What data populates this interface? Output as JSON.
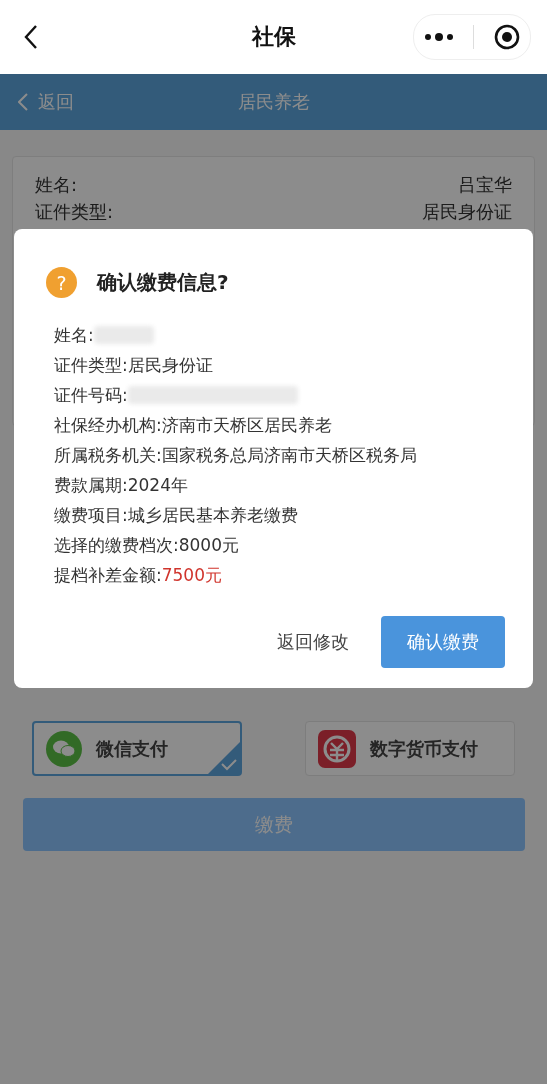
{
  "nav_bar": {
    "title": "社保"
  },
  "header": {
    "back_label": "返回",
    "title": "居民养老"
  },
  "info_card": {
    "rows": [
      {
        "label": "姓名:",
        "value": "吕宝华"
      },
      {
        "label": "证件类型:",
        "value": "居民身份证"
      }
    ]
  },
  "payment_methods": [
    {
      "label": "微信支付",
      "kind": "wechat",
      "selected": true
    },
    {
      "label": "数字货币支付",
      "kind": "digital",
      "selected": false
    }
  ],
  "pay_button": {
    "label": "缴费"
  },
  "dialog": {
    "title": "确认缴费信息?",
    "icon": "?",
    "rows": [
      {
        "label": "姓名:",
        "kind": "blurred_short"
      },
      {
        "label": "证件类型:",
        "kind": "text",
        "value": "居民身份证"
      },
      {
        "label": "证件号码:",
        "kind": "blurred_long"
      },
      {
        "label": "社保经办机构:",
        "kind": "text",
        "value": "济南市天桥区居民养老"
      },
      {
        "label": "所属税务机关:",
        "kind": "text",
        "value": "国家税务总局济南市天桥区税务局"
      },
      {
        "label": "费款属期:",
        "kind": "text",
        "value": "2024年"
      },
      {
        "label": "缴费项目:",
        "kind": "text",
        "value": "城乡居民基本养老缴费"
      },
      {
        "label": "选择的缴费档次:",
        "kind": "text",
        "value": "8000元"
      },
      {
        "label": "提档补差金额:",
        "kind": "highlight",
        "value": "7500元"
      }
    ],
    "cancel_label": "返回修改",
    "confirm_label": "确认缴费"
  }
}
